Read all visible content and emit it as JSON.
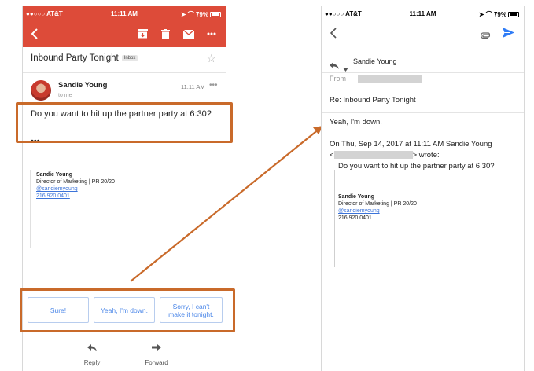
{
  "left": {
    "status": {
      "carrier": "●●○○○ AT&T",
      "time": "11:11 AM",
      "battery": "79%"
    },
    "toolbar": {
      "back": "back-icon",
      "archive": "archive-icon",
      "delete": "trash-icon",
      "mail": "mail-icon",
      "more": "more-icon"
    },
    "subject": "Inbound Party Tonight",
    "label": "Inbox",
    "sender": "Sandie Young",
    "to": "to me",
    "time": "11:11 AM",
    "more": "•••",
    "body": "Do you want to hit up the partner party at 6:30?",
    "ellipsis": "•••",
    "signature": {
      "name": "Sandie Young",
      "title": "Director of Marketing | PR 20/20",
      "handle": "@sandiemyoung",
      "phone": "216.920.0401"
    },
    "smart_replies": [
      "Sure!",
      "Yeah, I'm down.",
      "Sorry, I can't make it tonight."
    ],
    "actions": {
      "reply": "Reply",
      "forward": "Forward"
    }
  },
  "right": {
    "status": {
      "carrier": "●●○○○ AT&T",
      "time": "11:11 AM",
      "battery": "79%"
    },
    "sender": "Sandie Young",
    "from_label": "From",
    "subject": "Re: Inbound Party Tonight",
    "reply_text": "Yeah, I'm down.",
    "quote_intro": "On Thu, Sep 14, 2017 at 11:11 AM Sandie Young",
    "quote_lt": "<",
    "quote_gt": "> wrote:",
    "quoted_body": "Do you want to hit up the partner party at 6:30?",
    "signature": {
      "name": "Sandie Young",
      "title": "Director of Marketing | PR 20/20",
      "handle": "@sandiemyoung",
      "phone": "216.920.0401"
    }
  },
  "colors": {
    "gmail_red": "#dd4b39",
    "highlight": "#c96a2a",
    "link": "#3b73d9",
    "send_blue": "#2f7cf6"
  }
}
